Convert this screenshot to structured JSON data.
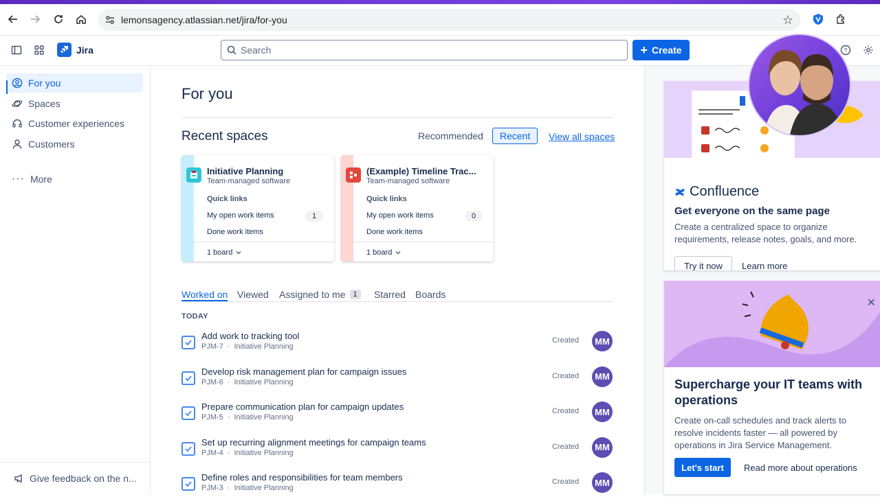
{
  "browser": {
    "url": "lemonsagency.atlassian.net/jira/for-you"
  },
  "header": {
    "app_name": "Jira",
    "search_placeholder": "Search",
    "create_label": "Create"
  },
  "sidebar": {
    "items": [
      {
        "label": "For you",
        "icon": "user-circle-icon"
      },
      {
        "label": "Spaces",
        "icon": "planet-icon"
      },
      {
        "label": "Customer experiences",
        "icon": "headset-icon"
      },
      {
        "label": "Customers",
        "icon": "person-icon"
      }
    ],
    "more_label": "More",
    "feedback_label": "Give feedback on the n..."
  },
  "main": {
    "title": "For you",
    "recent_spaces_title": "Recent spaces",
    "tabs": {
      "recommended": "Recommended",
      "recent": "Recent"
    },
    "view_all": "View all spaces",
    "spaces": [
      {
        "name": "Initiative Planning",
        "type": "Team-managed software",
        "quick_links": "Quick links",
        "open_items": "My open work items",
        "open_count": "1",
        "done_items": "Done work items",
        "board": "1 board",
        "strip_color": "#c6edfb",
        "icon_color": "#2fc5d6"
      },
      {
        "name": "(Example) Timeline Trac...",
        "type": "Team-managed software",
        "quick_links": "Quick links",
        "open_items": "My open work items",
        "open_count": "0",
        "done_items": "Done work items",
        "board": "1 board",
        "strip_color": "#ffd5d2",
        "icon_color": "#e2483d"
      }
    ],
    "work_tabs": {
      "worked_on": "Worked on",
      "viewed": "Viewed",
      "assigned": "Assigned to me",
      "assigned_count": "1",
      "starred": "Starred",
      "boards": "Boards"
    },
    "today_label": "TODAY",
    "items": [
      {
        "title": "Add work to tracking tool",
        "key": "PJM-7",
        "space": "Initiative Planning",
        "status": "Created",
        "avatar": "MM"
      },
      {
        "title": "Develop risk management plan for campaign issues",
        "key": "PJM-6",
        "space": "Initiative Planning",
        "status": "Created",
        "avatar": "MM"
      },
      {
        "title": "Prepare communication plan for campaign updates",
        "key": "PJM-5",
        "space": "Initiative Planning",
        "status": "Created",
        "avatar": "MM"
      },
      {
        "title": "Set up recurring alignment meetings for campaign teams",
        "key": "PJM-4",
        "space": "Initiative Planning",
        "status": "Created",
        "avatar": "MM"
      },
      {
        "title": "Define roles and responsibilities for team members",
        "key": "PJM-3",
        "space": "Initiative Planning",
        "status": "Created",
        "avatar": "MM"
      }
    ],
    "meta_separator": "·"
  },
  "right_panel": {
    "confluence": {
      "brand": "Confluence",
      "heading": "Get everyone on the same page",
      "body": "Create a centralized space to organize requirements, release notes, goals, and more.",
      "try_label": "Try it now",
      "learn_label": "Learn more"
    },
    "ops": {
      "heading": "Supercharge your IT teams with operations",
      "body": "Create on-call schedules and track alerts to resolve incidents faster — all powered by operations in Jira Service Management.",
      "start_label": "Let's start",
      "read_label": "Read more about operations"
    }
  }
}
